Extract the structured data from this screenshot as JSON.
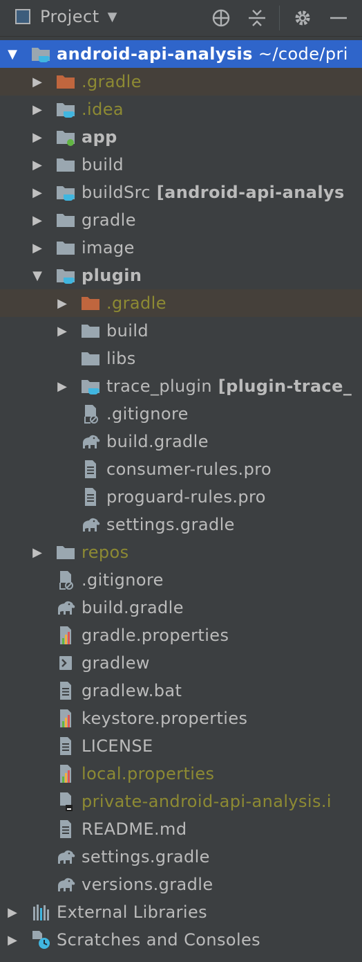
{
  "header": {
    "title": "Project",
    "icons": [
      "locate-icon",
      "collapse-all-icon",
      "gear-icon",
      "minimize-icon"
    ]
  },
  "tree": [
    {
      "label": "android-api-analysis",
      "suffix": "~/code/pri",
      "arrow": "down",
      "icon": "module-folder",
      "depth": 0,
      "bold": true,
      "selected": true
    },
    {
      "label": ".gradle",
      "arrow": "right",
      "icon": "excluded-folder",
      "depth": 1,
      "color": "olive",
      "hl": true
    },
    {
      "label": ".idea",
      "arrow": "right",
      "icon": "module-folder",
      "depth": 1,
      "color": "olive"
    },
    {
      "label": "app",
      "arrow": "right",
      "icon": "app-folder",
      "depth": 1,
      "bold": true
    },
    {
      "label": "build",
      "arrow": "right",
      "icon": "folder",
      "depth": 1
    },
    {
      "label": "buildSrc",
      "suffix": "[android-api-analys",
      "arrow": "right",
      "icon": "module-folder",
      "depth": 1
    },
    {
      "label": "gradle",
      "arrow": "right",
      "icon": "folder",
      "depth": 1
    },
    {
      "label": "image",
      "arrow": "right",
      "icon": "folder",
      "depth": 1
    },
    {
      "label": "plugin",
      "arrow": "down",
      "icon": "module-folder",
      "depth": 1,
      "bold": true
    },
    {
      "label": ".gradle",
      "arrow": "right",
      "icon": "excluded-folder",
      "depth": 2,
      "color": "olive",
      "hl": true
    },
    {
      "label": "build",
      "arrow": "right",
      "icon": "folder",
      "depth": 2
    },
    {
      "label": "libs",
      "arrow": "",
      "icon": "folder",
      "depth": 2
    },
    {
      "label": "trace_plugin",
      "suffix": "[plugin-trace_",
      "arrow": "right",
      "icon": "module-folder",
      "depth": 2
    },
    {
      "label": ".gitignore",
      "arrow": "",
      "icon": "ignore-file",
      "depth": 2
    },
    {
      "label": "build.gradle",
      "arrow": "",
      "icon": "gradle-file",
      "depth": 2
    },
    {
      "label": "consumer-rules.pro",
      "arrow": "",
      "icon": "text-file",
      "depth": 2
    },
    {
      "label": "proguard-rules.pro",
      "arrow": "",
      "icon": "text-file",
      "depth": 2
    },
    {
      "label": "settings.gradle",
      "arrow": "",
      "icon": "gradle-file",
      "depth": 2
    },
    {
      "label": "repos",
      "arrow": "right",
      "icon": "folder",
      "depth": 1,
      "color": "olive"
    },
    {
      "label": ".gitignore",
      "arrow": "",
      "icon": "ignore-file",
      "depth": 1
    },
    {
      "label": "build.gradle",
      "arrow": "",
      "icon": "gradle-file",
      "depth": 1
    },
    {
      "label": "gradle.properties",
      "arrow": "",
      "icon": "properties-file",
      "depth": 1
    },
    {
      "label": "gradlew",
      "arrow": "",
      "icon": "shell-file",
      "depth": 1
    },
    {
      "label": "gradlew.bat",
      "arrow": "",
      "icon": "text-file",
      "depth": 1
    },
    {
      "label": "keystore.properties",
      "arrow": "",
      "icon": "properties-file",
      "depth": 1
    },
    {
      "label": "LICENSE",
      "arrow": "",
      "icon": "text-file",
      "depth": 1
    },
    {
      "label": "local.properties",
      "arrow": "",
      "icon": "properties-file",
      "depth": 1,
      "color": "olive"
    },
    {
      "label": "private-android-api-analysis.i",
      "arrow": "",
      "icon": "iml-file",
      "depth": 1,
      "color": "olive"
    },
    {
      "label": "README.md",
      "arrow": "",
      "icon": "text-file",
      "depth": 1
    },
    {
      "label": "settings.gradle",
      "arrow": "",
      "icon": "gradle-file",
      "depth": 1
    },
    {
      "label": "versions.gradle",
      "arrow": "",
      "icon": "gradle-file",
      "depth": 1
    },
    {
      "label": "External Libraries",
      "arrow": "right",
      "icon": "libraries",
      "depth": 0
    },
    {
      "label": "Scratches and Consoles",
      "arrow": "right",
      "icon": "scratches",
      "depth": 0
    }
  ]
}
